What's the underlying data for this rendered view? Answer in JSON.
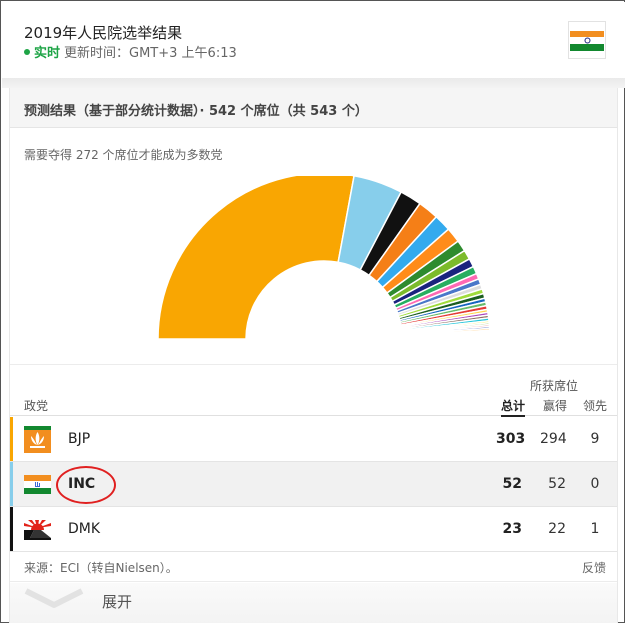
{
  "header": {
    "title": "2019年人民院选举结果",
    "live_label": "实时",
    "updated_text": "更新时间：GMT+3 上午6:13",
    "flag_icon": "india-flag-icon"
  },
  "card": {
    "heading": "预测结果（基于部分统计数据）· 542 个席位（共 543 个）",
    "majority_note": "需要夺得 272 个席位才能成为多数党"
  },
  "chart_data": {
    "type": "pie",
    "subtype": "half-donut",
    "total_seats": 543,
    "declared_seats": 542,
    "undeclared_color": "#767676",
    "slices": [
      {
        "value": 303,
        "color": "#f9a602"
      },
      {
        "value": 52,
        "color": "#87ceeb"
      },
      {
        "value": 23,
        "color": "#111111"
      },
      {
        "value": 22,
        "color": "#f57f17"
      },
      {
        "value": 18,
        "color": "#33aaee"
      },
      {
        "value": 16,
        "color": "#ff8c1a"
      },
      {
        "value": 12,
        "color": "#2e8b2e"
      },
      {
        "value": 10,
        "color": "#7cbb2b"
      },
      {
        "value": 9,
        "color": "#1a237e"
      },
      {
        "value": 8,
        "color": "#27ae60"
      },
      {
        "value": 6,
        "color": "#ff69b4"
      },
      {
        "value": 6,
        "color": "#4a77c9"
      },
      {
        "value": 5,
        "color": "#dddddd"
      },
      {
        "value": 5,
        "color": "#a0dc3c"
      },
      {
        "value": 5,
        "color": "#1b5e20"
      },
      {
        "value": 4,
        "color": "#1565c0"
      },
      {
        "value": 4,
        "color": "#66bb6a"
      },
      {
        "value": 4,
        "color": "#e53935"
      },
      {
        "value": 3,
        "color": "#ffd54f"
      },
      {
        "value": 3,
        "color": "#ab47bc"
      },
      {
        "value": 3,
        "color": "#8d6e63"
      },
      {
        "value": 3,
        "color": "#26c6da"
      },
      {
        "value": 2,
        "color": "#ffee58"
      },
      {
        "value": 2,
        "color": "#9ccc65"
      },
      {
        "value": 2,
        "color": "#ef9a9a"
      },
      {
        "value": 2,
        "color": "#5c6bc0"
      },
      {
        "value": 2,
        "color": "#ffb74d"
      },
      {
        "value": 1,
        "color": "#c0ca33"
      },
      {
        "value": 1,
        "color": "#f06292"
      },
      {
        "value": 1,
        "color": "#4db6ac"
      },
      {
        "value": 1,
        "color": "#aed581"
      },
      {
        "value": 1,
        "color": "#e0e0e0"
      },
      {
        "value": 1,
        "color": "#7e57c2"
      },
      {
        "value": 1,
        "color": "#90caf9"
      },
      {
        "value": 1,
        "color": "#ff7043"
      }
    ]
  },
  "table": {
    "col_party": "政党",
    "col_seats": "所获席位",
    "col_total": "总计",
    "col_won": "赢得",
    "col_lead": "领先",
    "rows": [
      {
        "name": "BJP",
        "total": "303",
        "won": "294",
        "lead": "9",
        "color": "#f9a602",
        "icon": "lotus-icon"
      },
      {
        "name": "INC",
        "total": "52",
        "won": "52",
        "lead": "0",
        "color": "#87ceeb",
        "icon": "hand-icon"
      },
      {
        "name": "DMK",
        "total": "23",
        "won": "22",
        "lead": "1",
        "color": "#111111",
        "icon": "rising-sun-icon"
      }
    ]
  },
  "footer": {
    "source": "来源：ECI（转自Nielsen）。",
    "feedback": "反馈",
    "expand": "展开"
  }
}
